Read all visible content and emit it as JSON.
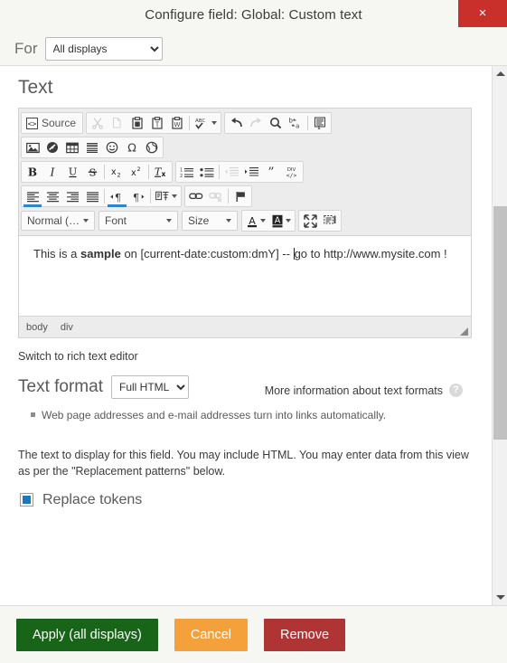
{
  "dialog": {
    "title": "Configure field: Global: Custom text",
    "close_label": "×"
  },
  "for_row": {
    "label": "For",
    "selected": "All displays",
    "options": [
      "All displays"
    ]
  },
  "section": {
    "title": "Text"
  },
  "editor": {
    "toolbar": {
      "row1": [
        {
          "name": "source-button",
          "label": "Source",
          "icon": "source-icon",
          "state": "enabled"
        },
        {
          "name": "cut-button",
          "label": "Cut",
          "icon": "scissors-icon",
          "state": "disabled"
        },
        {
          "name": "copy-button",
          "label": "Copy",
          "icon": "copy-icon",
          "state": "disabled"
        },
        {
          "name": "paste-button",
          "label": "Paste",
          "icon": "clipboard-icon",
          "state": "enabled"
        },
        {
          "name": "paste-as-text-button",
          "label": "Paste as plain text",
          "icon": "clipboard-text-icon",
          "state": "enabled"
        },
        {
          "name": "paste-from-word-button",
          "label": "Paste from Word",
          "icon": "clipboard-word-icon",
          "state": "enabled"
        },
        {
          "name": "spellcheck-button",
          "label": "ABC",
          "icon": "spellcheck-icon",
          "state": "enabled"
        },
        {
          "name": "undo-button",
          "label": "Undo",
          "icon": "undo-arrow-icon",
          "state": "enabled"
        },
        {
          "name": "redo-button",
          "label": "Redo",
          "icon": "redo-arrow-icon",
          "state": "disabled"
        },
        {
          "name": "find-button",
          "label": "Find",
          "icon": "magnifier-icon",
          "state": "enabled"
        },
        {
          "name": "replace-button",
          "label": "Replace",
          "icon": "replace-b-to-a-icon",
          "state": "enabled"
        },
        {
          "name": "select-all-button",
          "label": "Select All",
          "icon": "select-all-icon",
          "state": "enabled"
        }
      ],
      "row2": [
        {
          "name": "image-button",
          "label": "Image",
          "icon": "picture-icon",
          "state": "enabled"
        },
        {
          "name": "media-button",
          "label": "Media",
          "icon": "media-disc-icon",
          "state": "enabled"
        },
        {
          "name": "table-button",
          "label": "Table",
          "icon": "table-grid-icon",
          "state": "enabled"
        },
        {
          "name": "horizontal-rule-button",
          "label": "Horizontal line",
          "icon": "horizontal-rule-icon",
          "state": "enabled"
        },
        {
          "name": "smiley-button",
          "label": "Smiley",
          "icon": "smiley-face-icon",
          "state": "enabled"
        },
        {
          "name": "special-char-button",
          "label": "Special character",
          "icon": "omega-icon",
          "state": "enabled"
        },
        {
          "name": "iframe-button",
          "label": "IFrame",
          "icon": "globe-icon",
          "state": "enabled"
        }
      ],
      "row3": [
        {
          "name": "bold-button",
          "label": "B",
          "icon": "bold-icon",
          "state": "enabled"
        },
        {
          "name": "italic-button",
          "label": "I",
          "icon": "italic-icon",
          "state": "enabled"
        },
        {
          "name": "underline-button",
          "label": "U",
          "icon": "underline-icon",
          "state": "enabled"
        },
        {
          "name": "strikethrough-button",
          "label": "S",
          "icon": "strikethrough-icon",
          "state": "enabled"
        },
        {
          "name": "subscript-button",
          "label": "x₂",
          "icon": "subscript-icon",
          "state": "enabled"
        },
        {
          "name": "superscript-button",
          "label": "x²",
          "icon": "superscript-icon",
          "state": "enabled"
        },
        {
          "name": "remove-format-button",
          "label": "Tx",
          "icon": "remove-format-icon",
          "state": "enabled"
        },
        {
          "name": "numbered-list-button",
          "label": "Numbered list",
          "icon": "numbered-list-icon",
          "state": "enabled"
        },
        {
          "name": "bulleted-list-button",
          "label": "Bulleted list",
          "icon": "bulleted-list-icon",
          "state": "enabled"
        },
        {
          "name": "decrease-indent-button",
          "label": "Decrease indent",
          "icon": "outdent-icon",
          "state": "disabled"
        },
        {
          "name": "increase-indent-button",
          "label": "Increase indent",
          "icon": "indent-icon",
          "state": "enabled"
        },
        {
          "name": "blockquote-button",
          "label": "Block quote",
          "icon": "quote-icon",
          "state": "enabled"
        },
        {
          "name": "create-div-button",
          "label": "DIV",
          "icon": "div-container-icon",
          "state": "enabled"
        }
      ],
      "row4": [
        {
          "name": "align-left-button",
          "label": "Align left",
          "icon": "align-left-icon",
          "state": "active"
        },
        {
          "name": "align-center-button",
          "label": "Center",
          "icon": "align-center-icon",
          "state": "enabled"
        },
        {
          "name": "align-right-button",
          "label": "Align right",
          "icon": "align-right-icon",
          "state": "enabled"
        },
        {
          "name": "justify-button",
          "label": "Justify",
          "icon": "align-justify-icon",
          "state": "enabled"
        },
        {
          "name": "ltr-button",
          "label": "Text direction left to right",
          "icon": "ltr-pilcrow-icon",
          "state": "active"
        },
        {
          "name": "rtl-button",
          "label": "Text direction right to left",
          "icon": "rtl-pilcrow-icon",
          "state": "enabled"
        },
        {
          "name": "language-button",
          "label": "Set language",
          "icon": "language-icon",
          "state": "enabled"
        },
        {
          "name": "link-button",
          "label": "Link",
          "icon": "chain-link-icon",
          "state": "enabled"
        },
        {
          "name": "unlink-button",
          "label": "Unlink",
          "icon": "broken-link-icon",
          "state": "disabled"
        },
        {
          "name": "anchor-button",
          "label": "Anchor",
          "icon": "flag-anchor-icon",
          "state": "enabled"
        }
      ],
      "row5": [
        {
          "name": "paragraph-format-combo",
          "label": "Normal (…",
          "icon": "chevron-down-icon",
          "state": "enabled"
        },
        {
          "name": "font-family-combo",
          "label": "Font",
          "icon": "chevron-down-icon",
          "state": "enabled"
        },
        {
          "name": "font-size-combo",
          "label": "Size",
          "icon": "chevron-down-icon",
          "state": "enabled"
        },
        {
          "name": "text-color-button",
          "label": "A",
          "icon": "text-color-icon",
          "state": "enabled"
        },
        {
          "name": "background-color-button",
          "label": "A",
          "icon": "background-color-icon",
          "state": "enabled"
        },
        {
          "name": "maximize-button",
          "label": "Maximize",
          "icon": "maximize-arrows-icon",
          "state": "enabled"
        },
        {
          "name": "show-blocks-button",
          "label": "Show blocks",
          "icon": "show-blocks-icon",
          "state": "enabled"
        }
      ]
    },
    "content": {
      "before_bold": "This is a ",
      "bold": "sample",
      "after_bold": " on [current-date:custom:dmY] -- ",
      "after_caret": "go to http://www.mysite.com !"
    },
    "elements_path": [
      "body",
      "div"
    ]
  },
  "switch_editor": {
    "label": "Switch to rich text editor"
  },
  "text_format": {
    "label": "Text format",
    "selected": "Full HTML",
    "options": [
      "Full HTML"
    ],
    "more_info_label": "More information about text formats",
    "help_icon": "?",
    "tips": [
      "Web page addresses and e-mail addresses turn into links automatically."
    ]
  },
  "description": {
    "text": "The text to display for this field. You may include HTML. You may enter data from this view as per the \"Replacement patterns\" below."
  },
  "replace_tokens": {
    "label": "Replace tokens",
    "checked": true
  },
  "footer": {
    "apply_label": "Apply (all displays)",
    "cancel_label": "Cancel",
    "remove_label": "Remove"
  },
  "colors": {
    "apply": "#186418",
    "cancel": "#f4a13c",
    "remove": "#b03434",
    "close": "#c9302c",
    "accent_active": "#2b87c8",
    "checkbox": "#1a79b8"
  }
}
